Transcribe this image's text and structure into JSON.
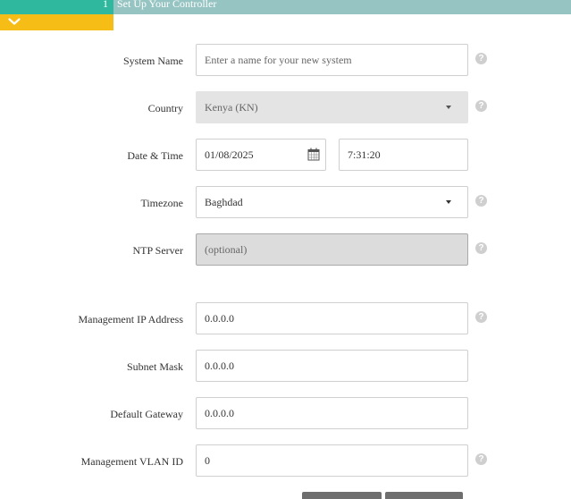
{
  "header": {
    "step_number": "1",
    "title": "Set Up Your Controller"
  },
  "colors": {
    "header_bar": "#95c4c2",
    "header_accent": "#2fb89d",
    "collapse_tab": "#f5bd15",
    "help_icon": "#cfcfcf"
  },
  "form": {
    "system_name": {
      "label": "System Name",
      "placeholder": "Enter a name for your new system",
      "value": ""
    },
    "country": {
      "label": "Country",
      "value": "Kenya (KN)"
    },
    "date_time": {
      "label": "Date & Time",
      "date": "01/08/2025",
      "time": "7:31:20"
    },
    "timezone": {
      "label": "Timezone",
      "value": "Baghdad"
    },
    "ntp_server": {
      "label": "NTP Server",
      "placeholder": "(optional)"
    },
    "management_ip": {
      "label": "Management IP Address",
      "value": "0.0.0.0"
    },
    "subnet_mask": {
      "label": "Subnet Mask",
      "value": "0.0.0.0"
    },
    "default_gateway": {
      "label": "Default Gateway",
      "value": "0.0.0.0"
    },
    "management_vlan": {
      "label": "Management VLAN ID",
      "value": "0"
    }
  },
  "icons": {
    "help": "?",
    "collapse": "chevron-down-icon",
    "calendar": "calendar-icon",
    "dropdown": "caret-down-icon"
  }
}
